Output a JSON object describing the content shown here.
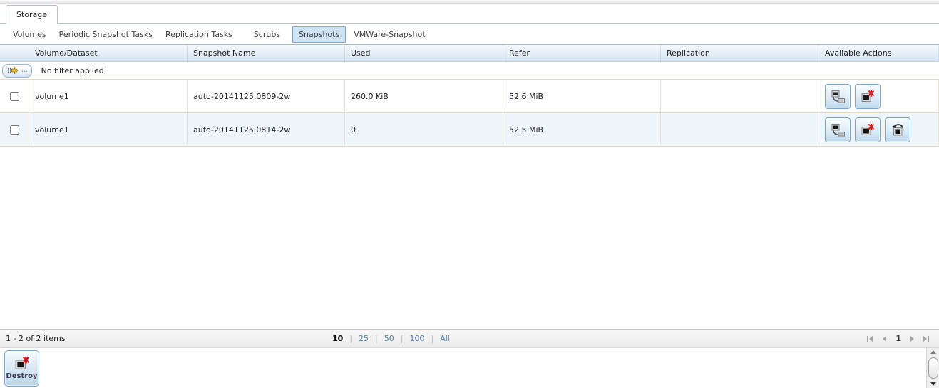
{
  "page": {
    "tab": "Storage",
    "subtabs": [
      {
        "label": "Volumes"
      },
      {
        "label": "Periodic Snapshot Tasks"
      },
      {
        "label": "Replication Tasks"
      },
      {
        "label": "Scrubs"
      },
      {
        "label": "Snapshots"
      },
      {
        "label": "VMWare-Snapshot"
      }
    ],
    "active_subtab": "Snapshots"
  },
  "grid": {
    "columns": {
      "volume": "Volume/Dataset",
      "snapshot": "Snapshot Name",
      "used": "Used",
      "refer": "Refer",
      "replication": "Replication",
      "actions": "Available Actions"
    },
    "filter": {
      "button_label": "...",
      "status": "No filter applied"
    },
    "rows": [
      {
        "volume": "volume1",
        "snapshot": "auto-20141125.0809-2w",
        "used": "260.0 KiB",
        "refer": "52.6 MiB",
        "replication": "",
        "actions": [
          "clone",
          "destroy"
        ]
      },
      {
        "volume": "volume1",
        "snapshot": "auto-20141125.0814-2w",
        "used": "0",
        "refer": "52.5 MiB",
        "replication": "",
        "actions": [
          "clone",
          "destroy",
          "rollback"
        ]
      }
    ]
  },
  "pager": {
    "summary": "1 - 2 of 2 items",
    "sizes": [
      "10",
      "25",
      "50",
      "100",
      "All"
    ],
    "active_size": "10",
    "separator": "|",
    "page": "1"
  },
  "footer": {
    "destroy_label": "Destroy"
  },
  "colors": {
    "accent_border": "#7ba3c8",
    "selected_subtab_bg": "#cfe3f5",
    "header_gradient_top": "#f4f9fc",
    "header_gradient_bottom": "#d6e5f2",
    "row_alt_bg": "#eff6fb",
    "cell_border": "#e5dbc5",
    "link": "#4d7fad",
    "destroy_red": "#cf1b1b"
  }
}
